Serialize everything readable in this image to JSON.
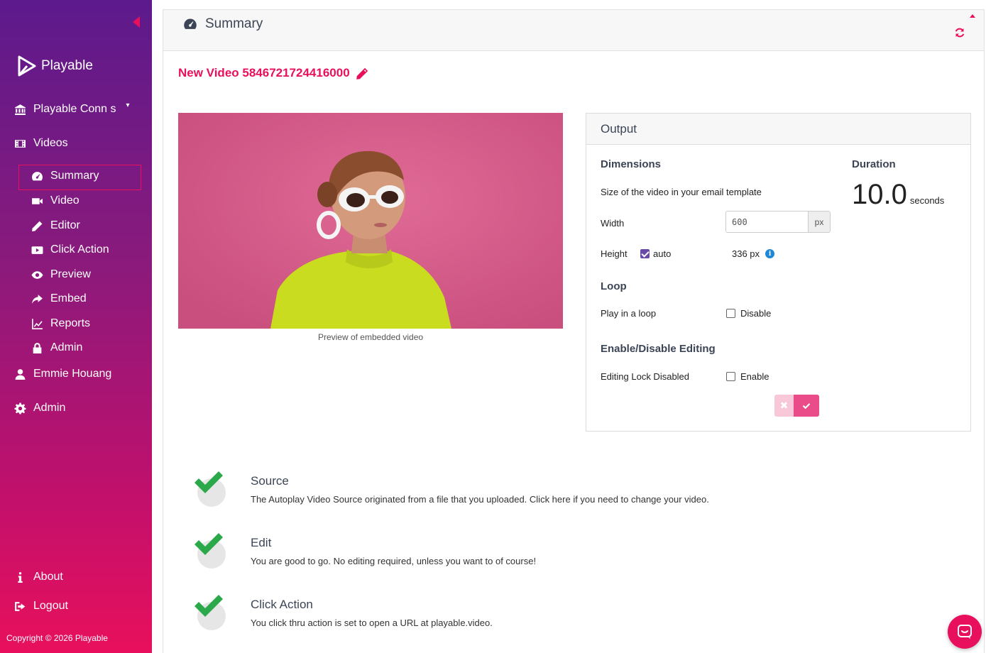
{
  "sidebar": {
    "logo_text": "Playable",
    "account_label": "Playable Conn s",
    "videos_label": "Videos",
    "sub_items": [
      "Summary",
      "Video",
      "Editor",
      "Click Action",
      "Preview",
      "Embed",
      "Reports",
      "Admin"
    ],
    "user_label": "Emmie Houang",
    "admin_label": "Admin",
    "about_label": "About",
    "logout_label": "Logout",
    "copyright": "Copyright  © 2026 Playable"
  },
  "panel": {
    "title": "Summary",
    "video_title": "New Video 5846721724416000",
    "preview_caption": "Preview of embedded video"
  },
  "output": {
    "heading": "Output",
    "dimensions_heading": "Dimensions",
    "dimensions_desc": "Size of the video in your email template",
    "width_label": "Width",
    "width_value": "600",
    "width_unit": "px",
    "height_label": "Height",
    "height_auto_label": "auto",
    "height_auto_checked": true,
    "height_value": "336 px",
    "loop_heading": "Loop",
    "loop_label": "Play in a loop",
    "loop_option": "Disable",
    "editing_heading": "Enable/Disable Editing",
    "editing_label": "Editing Lock Disabled",
    "editing_option": "Enable",
    "duration_heading": "Duration",
    "duration_value": "10.0",
    "duration_unit": "seconds"
  },
  "status_items": [
    {
      "title": "Source",
      "desc": "The Autoplay Video Source originated from a file that you uploaded. Click here if you need to change your video."
    },
    {
      "title": "Edit",
      "desc": "You are good to go. No editing required, unless you want to of course!"
    },
    {
      "title": "Click Action",
      "desc": "You click thru action is set to open a URL at playable.video."
    }
  ],
  "colors": {
    "accent": "#e8105c",
    "check_green": "#2aa84a",
    "sidebar_top": "#5c1a8c",
    "sidebar_bottom": "#e8105c"
  },
  "icons": {
    "summary": "dashboard-icon",
    "refresh": "refresh-icon",
    "edit": "pencil-icon",
    "chat": "chat-icon"
  }
}
